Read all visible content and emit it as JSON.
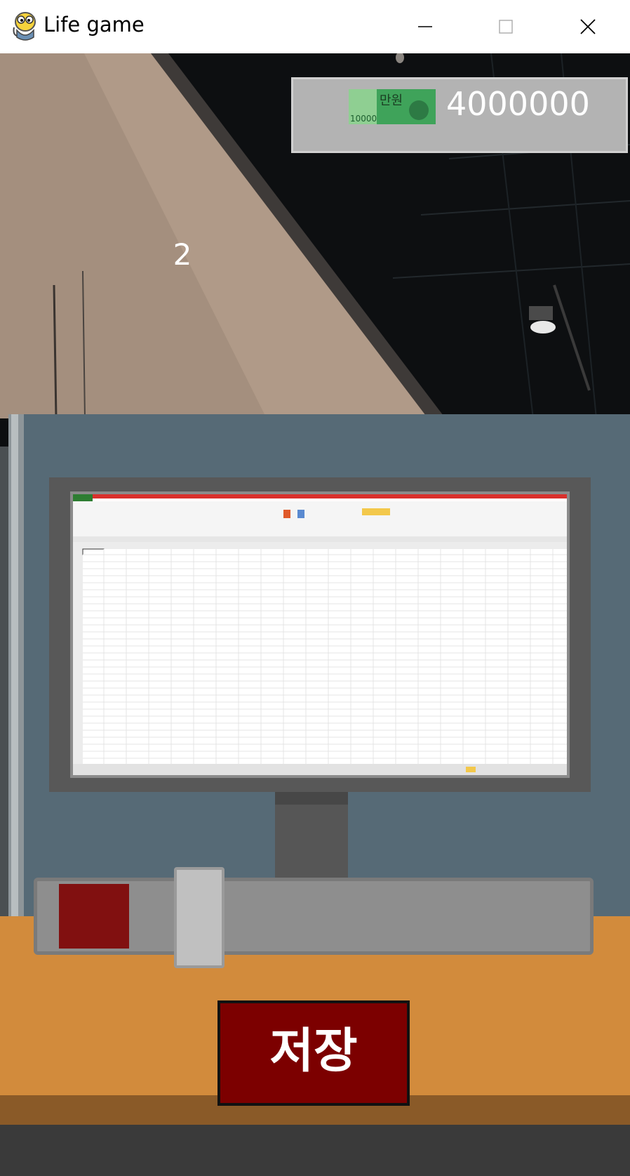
{
  "window": {
    "title": "Life game",
    "icon": "python-snake-icon",
    "controls": [
      "minimize-icon",
      "maximize-icon",
      "close-icon"
    ]
  },
  "hud": {
    "money": "4000000",
    "bill_icon": "10000-won-banknote-icon",
    "bill_label": "만원",
    "bill_denomination": "10000",
    "counter": "2"
  },
  "workspace": {
    "monitor_content": "spreadsheet-screenshot"
  },
  "progress": {
    "fill_fraction": 0.12,
    "fill_color": "#811010"
  },
  "actions": {
    "save_label": "저장"
  }
}
